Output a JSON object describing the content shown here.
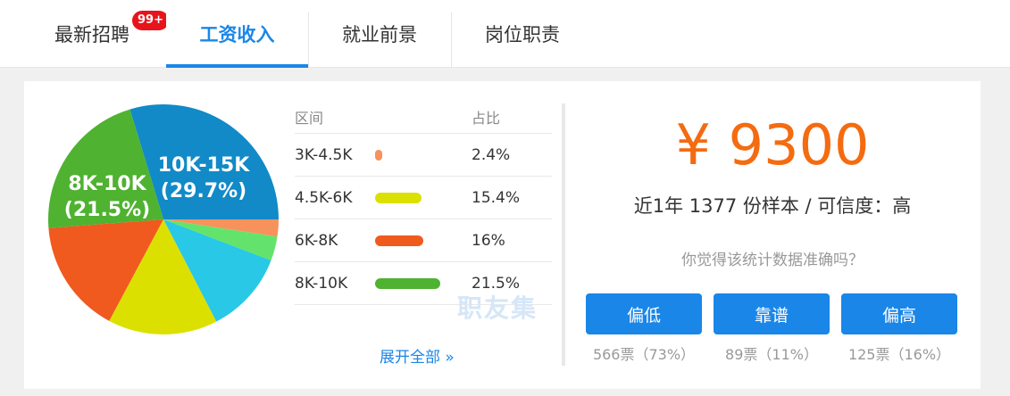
{
  "tabs": [
    {
      "label": "最新招聘",
      "badge": "99+"
    },
    {
      "label": "工资收入",
      "active": true
    },
    {
      "label": "就业前景"
    },
    {
      "label": "岗位职责"
    }
  ],
  "table": {
    "headers": {
      "range": "区间",
      "ratio": "占比"
    },
    "rows": [
      {
        "range": "3K-4.5K",
        "ratio": "2.4%",
        "value": 2.4,
        "color": "#f7925c"
      },
      {
        "range": "4.5K-6K",
        "ratio": "15.4%",
        "value": 15.4,
        "color": "#dce000"
      },
      {
        "range": "6K-8K",
        "ratio": "16%",
        "value": 16,
        "color": "#f05a1e"
      },
      {
        "range": "8K-10K",
        "ratio": "21.5%",
        "value": 21.5,
        "color": "#4fb231"
      }
    ],
    "expand_label": "展开全部 »",
    "watermark": "职友集"
  },
  "chart_data": {
    "type": "pie",
    "slices": [
      {
        "label": "10K-15K",
        "value": 29.7,
        "color": "#118ac7",
        "display": "10K-15K\n(29.7%)"
      },
      {
        "label": "3K-4.5K",
        "value": 2.4,
        "color": "#f7925c"
      },
      {
        "label": "",
        "value": 3.4,
        "color": "#64e36c"
      },
      {
        "label": "",
        "value": 11.6,
        "color": "#28c8e6"
      },
      {
        "label": "4.5K-6K",
        "value": 15.4,
        "color": "#dce000"
      },
      {
        "label": "6K-8K",
        "value": 16,
        "color": "#f05a1e"
      },
      {
        "label": "8K-10K",
        "value": 21.5,
        "color": "#4fb231",
        "display": "8K-10K\n(21.5%)"
      }
    ],
    "labeled": [
      {
        "line1": "10K-15K",
        "line2": "(29.7%)"
      },
      {
        "line1": "8K-10K",
        "line2": "(21.5%)"
      }
    ]
  },
  "summary": {
    "salary": "¥ 9300",
    "sample": "近1年 1377 份样本 / 可信度：高",
    "question": "你觉得该统计数据准确吗？"
  },
  "votes": [
    {
      "label": "偏低",
      "count": "566票（73%）"
    },
    {
      "label": "靠谱",
      "count": "89票（11%）"
    },
    {
      "label": "偏高",
      "count": "125票（16%）"
    }
  ]
}
